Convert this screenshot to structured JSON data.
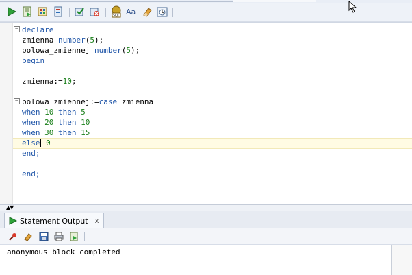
{
  "toolbar": {
    "buttons": [
      {
        "name": "run-statement-icon"
      },
      {
        "name": "run-script-icon"
      },
      {
        "name": "explain-plan-icon"
      },
      {
        "name": "autotrace-icon"
      },
      {
        "name": "commit-icon"
      },
      {
        "name": "rollback-icon"
      },
      {
        "name": "sql-tuning-icon"
      },
      {
        "name": "to-upper-lower-icon"
      },
      {
        "name": "clear-icon"
      },
      {
        "name": "history-icon"
      }
    ]
  },
  "editor": {
    "lines": [
      {
        "parts": [
          {
            "t": "declare",
            "c": "kw"
          }
        ]
      },
      {
        "parts": [
          {
            "t": "zmienna ",
            "c": ""
          },
          {
            "t": "number",
            "c": "kw"
          },
          {
            "t": "(",
            "c": ""
          },
          {
            "t": "5",
            "c": "num"
          },
          {
            "t": ");",
            "c": ""
          }
        ]
      },
      {
        "parts": [
          {
            "t": "polowa_zmiennej ",
            "c": ""
          },
          {
            "t": "number",
            "c": "kw"
          },
          {
            "t": "(",
            "c": ""
          },
          {
            "t": "5",
            "c": "num"
          },
          {
            "t": ");",
            "c": ""
          }
        ]
      },
      {
        "parts": [
          {
            "t": "begin",
            "c": "kw"
          }
        ]
      },
      {
        "parts": []
      },
      {
        "parts": [
          {
            "t": "zmienna:=",
            "c": ""
          },
          {
            "t": "10",
            "c": "num"
          },
          {
            "t": ";",
            "c": ""
          }
        ]
      },
      {
        "parts": []
      },
      {
        "parts": [
          {
            "t": "polowa_zmiennej:=",
            "c": ""
          },
          {
            "t": "case",
            "c": "kw"
          },
          {
            "t": " zmienna",
            "c": ""
          }
        ]
      },
      {
        "parts": [
          {
            "t": "when",
            "c": "kw"
          },
          {
            "t": " ",
            "c": ""
          },
          {
            "t": "10",
            "c": "num"
          },
          {
            "t": " ",
            "c": ""
          },
          {
            "t": "then",
            "c": "kw"
          },
          {
            "t": " ",
            "c": ""
          },
          {
            "t": "5",
            "c": "num"
          }
        ]
      },
      {
        "parts": [
          {
            "t": "when",
            "c": "kw"
          },
          {
            "t": " ",
            "c": ""
          },
          {
            "t": "20",
            "c": "num"
          },
          {
            "t": " ",
            "c": ""
          },
          {
            "t": "then",
            "c": "kw"
          },
          {
            "t": " ",
            "c": ""
          },
          {
            "t": "10",
            "c": "num"
          }
        ]
      },
      {
        "parts": [
          {
            "t": "when",
            "c": "kw"
          },
          {
            "t": " ",
            "c": ""
          },
          {
            "t": "30",
            "c": "num"
          },
          {
            "t": " ",
            "c": ""
          },
          {
            "t": "then",
            "c": "kw"
          },
          {
            "t": " ",
            "c": ""
          },
          {
            "t": "15",
            "c": "num"
          }
        ]
      },
      {
        "parts": [
          {
            "t": "else",
            "c": "kw"
          },
          {
            "t": "CARET",
            "c": ""
          },
          {
            "t": " ",
            "c": ""
          },
          {
            "t": "0",
            "c": "num"
          }
        ]
      },
      {
        "parts": [
          {
            "t": "end;",
            "c": "kw"
          }
        ]
      },
      {
        "parts": []
      },
      {
        "parts": [
          {
            "t": "end;",
            "c": "kw"
          }
        ]
      }
    ]
  },
  "output": {
    "tab_label": "Statement Output",
    "close_label": "x",
    "toolbar": [
      {
        "name": "pin-icon"
      },
      {
        "name": "eraser-icon"
      },
      {
        "name": "save-icon"
      },
      {
        "name": "print-icon"
      },
      {
        "name": "export-icon"
      }
    ],
    "message": "anonymous block completed"
  }
}
